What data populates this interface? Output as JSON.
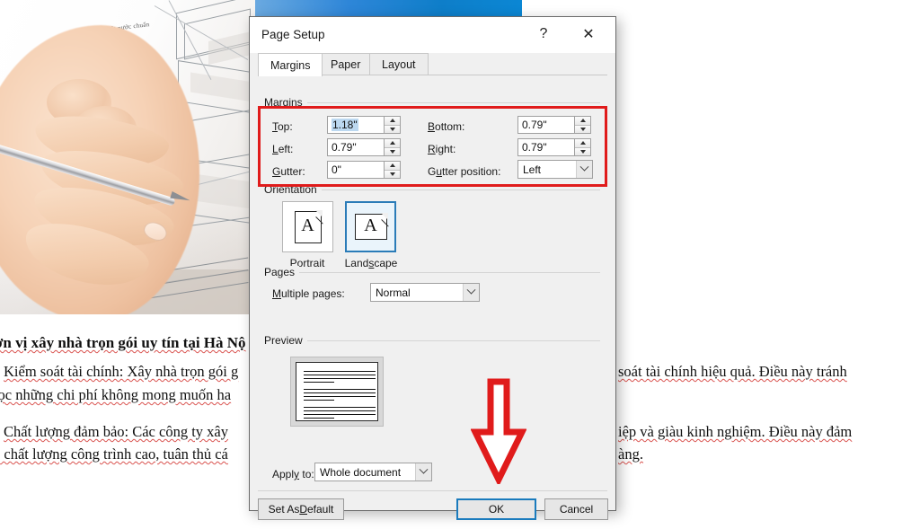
{
  "document": {
    "heading": "ơn vị xây nhà trọn gói uy tín tại Hà Nộ",
    "paragraphs": [
      {
        "left": "Kiểm soát tài chính: Xây nhà trọn gói g",
        "right": "soát tài chính hiệu quả. Điều này tránh"
      },
      {
        "left": "rọc những chi phí không mong muốn ha",
        "right": ""
      },
      {
        "left": "Chất lượng đảm bảo: Các công ty xây",
        "right": "iệp và giàu kinh nghiệm. Điều này đảm"
      },
      {
        "left": "o chất lượng công trình cao, tuân thủ cá",
        "right": "àng."
      }
    ]
  },
  "dialog": {
    "title": "Page Setup",
    "help_icon": "question-mark-icon",
    "close_icon": "close-icon",
    "help_glyph": "?",
    "close_glyph": "✕",
    "tabs": [
      {
        "label": "Margins",
        "active": true
      },
      {
        "label": "Paper",
        "active": false
      },
      {
        "label": "Layout",
        "active": false
      }
    ],
    "margins": {
      "group_label": "Margins",
      "fields": [
        {
          "label": "Top:",
          "accel": "T",
          "value": "1.18\"",
          "selected": true
        },
        {
          "label": "Bottom:",
          "accel": "B",
          "value": "0.79\"",
          "selected": false
        },
        {
          "label": "Left:",
          "accel": "L",
          "value": "0.79\"",
          "selected": false
        },
        {
          "label": "Right:",
          "accel": "R",
          "value": "0.79\"",
          "selected": false
        },
        {
          "label": "Gutter:",
          "accel": "G",
          "value": "0\"",
          "selected": false
        }
      ],
      "gutter_position": {
        "label": "Gutter position:",
        "accel": "u",
        "value": "Left"
      }
    },
    "orientation": {
      "group_label": "Orientation",
      "options": [
        {
          "label": "Portrait",
          "icon": "page-portrait-icon",
          "selected": false
        },
        {
          "label": "Landscape",
          "icon": "page-landscape-icon",
          "selected": true
        }
      ]
    },
    "pages": {
      "group_label": "Pages",
      "multiple_pages_label": "Multiple pages:",
      "multiple_pages_value": "Normal"
    },
    "preview": {
      "group_label": "Preview",
      "apply_to_label": "Apply to:",
      "apply_to_value": "Whole document"
    },
    "footer": {
      "set_as_default": "Set As Default",
      "ok": "OK",
      "cancel": "Cancel"
    }
  },
  "annotations": {
    "highlight_box_color": "#e01b1b",
    "arrow_color": "#e01b1b",
    "arrow_icon": "down-arrow-annotation-icon"
  },
  "colors": {
    "accent_blue": "#1a7bbd",
    "selection_blue": "#bcd8f0",
    "dialog_bg": "#f0f0f0",
    "spell_error": "#d9534f"
  }
}
